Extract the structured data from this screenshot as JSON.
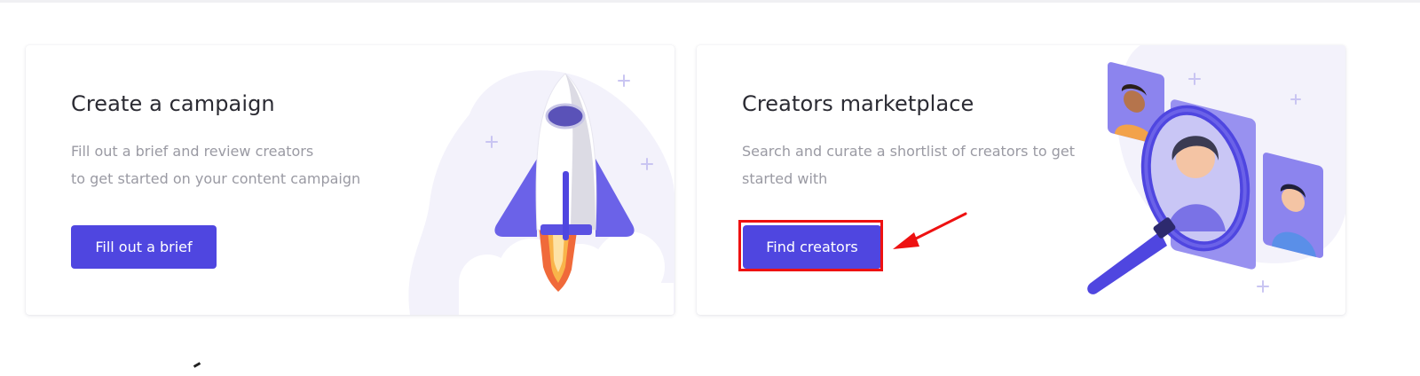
{
  "cards": {
    "campaign": {
      "title": "Create a campaign",
      "description_line1": "Fill out a brief and review creators",
      "description_line2": "to get started on your content campaign",
      "button_label": "Fill out a brief"
    },
    "marketplace": {
      "title": "Creators marketplace",
      "description_line1": "Search and curate a shortlist of creators to get",
      "description_line2": "started with",
      "button_label": "Find creators"
    }
  },
  "colors": {
    "accent": "#4f46e0",
    "highlight": "#ee1111",
    "illustration_bg": "#f3f2fb"
  },
  "icons": [
    "rocket-illustration",
    "magnifier-creators-illustration",
    "annotation-arrow-icon"
  ]
}
